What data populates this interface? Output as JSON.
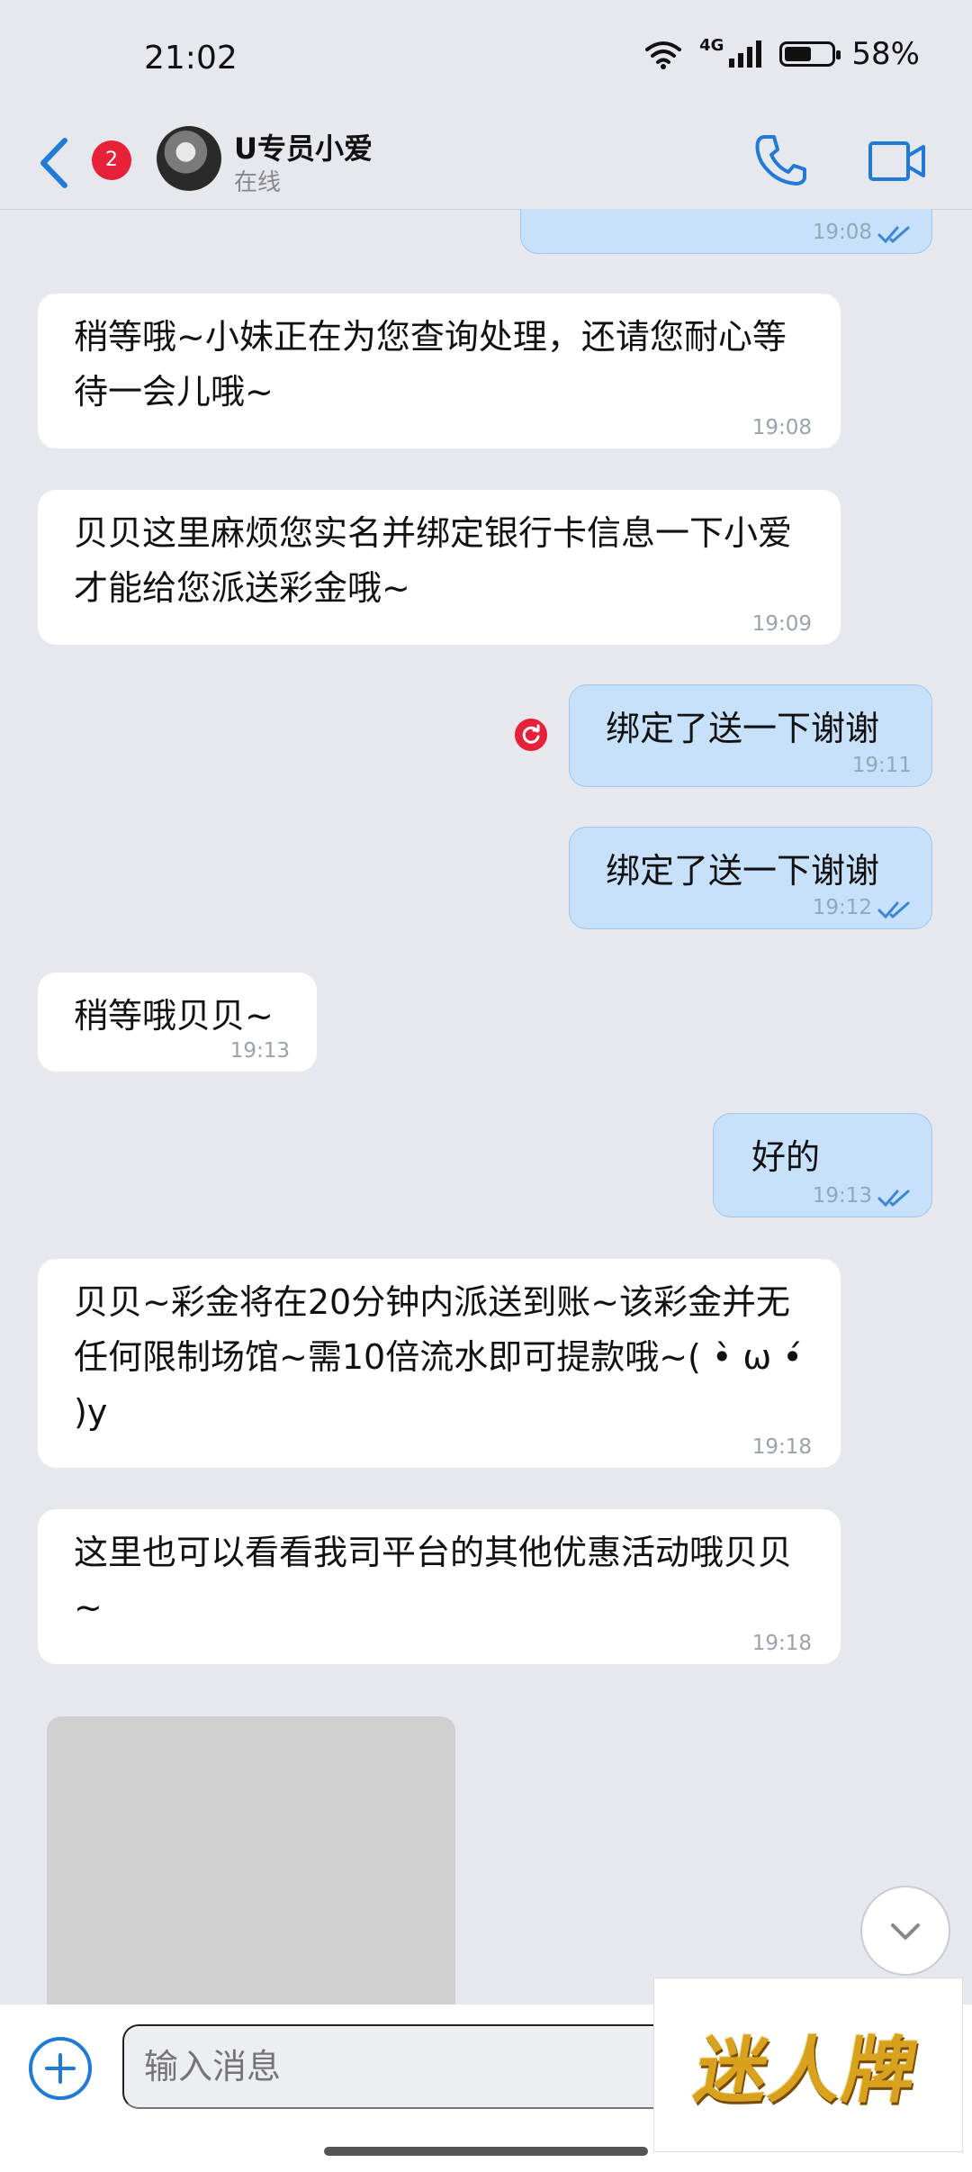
{
  "status_bar": {
    "time": "21:02",
    "network": "4G",
    "battery": "58%",
    "battery_level": 0.58
  },
  "header": {
    "back_badge": "2",
    "contact_name": "U专员小爱",
    "contact_status": "在线"
  },
  "messages": [
    {
      "dir": "out",
      "text": "",
      "time": "19:08",
      "read": true
    },
    {
      "dir": "in",
      "text": "稍等哦~小妹正在为您查询处理，还请您耐心等待一会儿哦~",
      "time": "19:08"
    },
    {
      "dir": "in",
      "text": "贝贝这里麻烦您实名并绑定银行卡信息一下小爱才能给您派送彩金哦~",
      "time": "19:09"
    },
    {
      "dir": "out",
      "text": "绑定了送一下谢谢",
      "time": "19:11",
      "read": false,
      "failed": true
    },
    {
      "dir": "out",
      "text": "绑定了送一下谢谢",
      "time": "19:12",
      "read": true
    },
    {
      "dir": "in",
      "text": "稍等哦贝贝~",
      "time": "19:13"
    },
    {
      "dir": "out",
      "text": "好的",
      "time": "19:13",
      "read": true
    },
    {
      "dir": "in",
      "text": "贝贝~彩金将在20分钟内派送到账~该彩金并无任何限制场馆~需10倍流水即可提款哦~( •̀ ω •́ )y",
      "time": "19:18"
    },
    {
      "dir": "in",
      "text": "这里也可以看看我司平台的其他优惠活动哦贝贝~",
      "time": "19:18"
    }
  ],
  "composer": {
    "placeholder": "输入消息"
  },
  "watermark": {
    "text": "迷人牌"
  },
  "colors": {
    "accent": "#1f7ad8",
    "outgoing_bubble": "#c8e1fb",
    "incoming_bubble": "#ffffff",
    "badge": "#e8213b"
  }
}
